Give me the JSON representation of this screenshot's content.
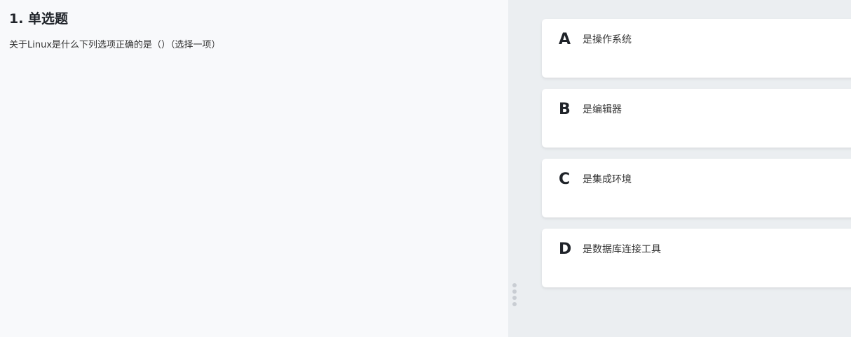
{
  "question": {
    "title": "1. 单选题",
    "stem": "关于Linux是什么下列选项正确的是（）（选择一项）"
  },
  "options": [
    {
      "letter": "A",
      "text": "是操作系统"
    },
    {
      "letter": "B",
      "text": "是编辑器"
    },
    {
      "letter": "C",
      "text": "是集成环境"
    },
    {
      "letter": "D",
      "text": "是数据库连接工具"
    }
  ]
}
